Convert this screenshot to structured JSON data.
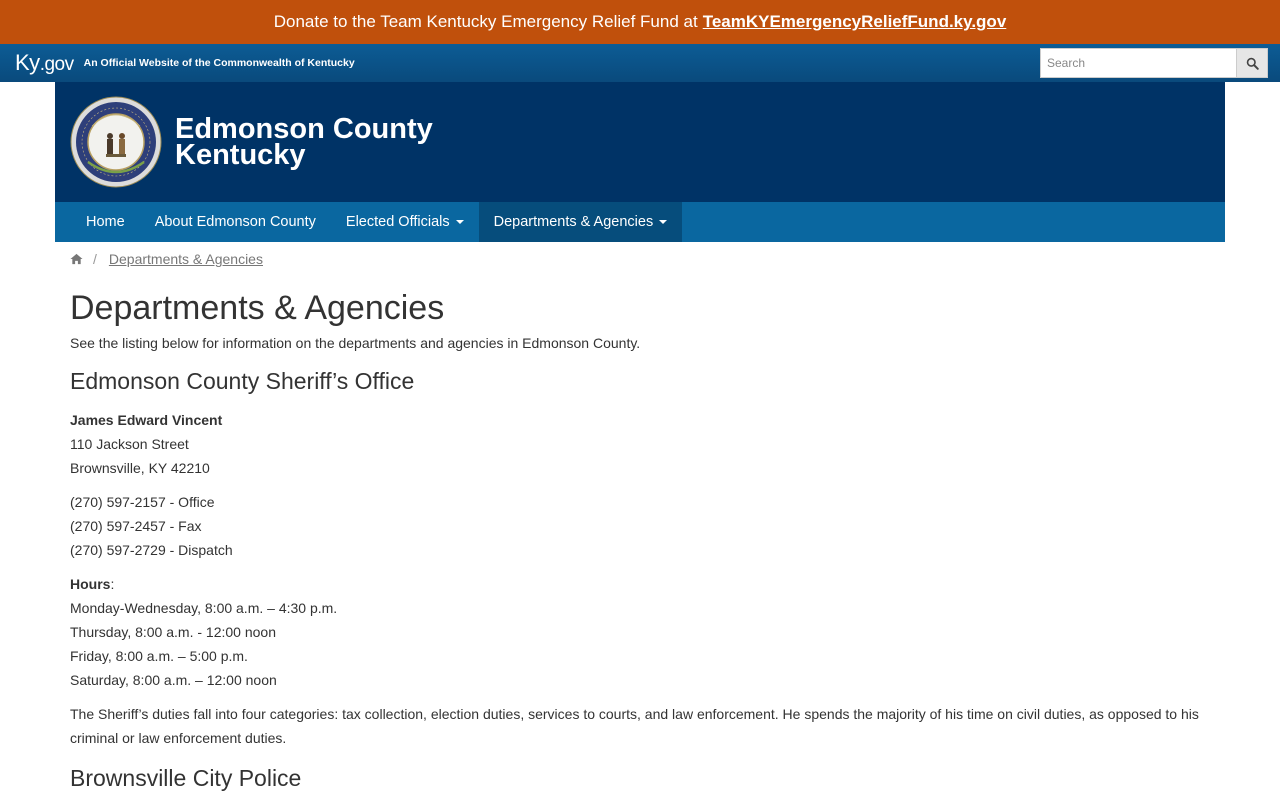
{
  "donate": {
    "text": "Donate to the Team Kentucky Emergency Relief Fund at",
    "link": "TeamKYEmergencyReliefFund.ky.gov"
  },
  "kygov": {
    "logo_ky": "Ky",
    "logo_gov": ".gov",
    "tagline": "An Official Website of the Commonwealth of Kentucky",
    "search_placeholder": "Search"
  },
  "header": {
    "title_line1": "Edmonson County",
    "title_line2": "Kentucky"
  },
  "nav": [
    {
      "label": "Home"
    },
    {
      "label": "About Edmonson County"
    },
    {
      "label": "Elected Officials"
    },
    {
      "label": "Departments & Agencies"
    }
  ],
  "breadcrumb": {
    "separator": "/",
    "current": "Departments & Agencies"
  },
  "page": {
    "title": "Departments & Agencies",
    "intro": "See the listing below for information on the departments and agencies in Edmonson County."
  },
  "sheriff": {
    "heading": "Edmonson County Sheriff’s Office",
    "name": "James Edward Vincent",
    "address1": "110 Jackson Street",
    "address2": "Brownsville, KY 42210",
    "phone_office": "(270) 597-2157 - Office",
    "phone_fax": "(270) 597-2457 - Fax",
    "phone_dispatch": "(270) 597-2729 - Dispatch",
    "hours_label": "Hours",
    "hours": [
      "Monday-Wednesday, 8:00 a.m. – 4:30 p.m.",
      "Thursday, 8:00 a.m. - 12:00 noon",
      "Friday, 8:00 a.m. – 5:00 p.m.",
      "Saturday, 8:00 a.m. – 12:00 noon"
    ],
    "description": "The Sheriff’s duties fall into four categories:  tax collection, election duties, services to courts, and law enforcement.  He spends the majority of his time on civil duties, as opposed to his criminal or law enforcement duties."
  },
  "police": {
    "heading": "Brownsville City Police"
  },
  "colors": {
    "donate_bar": "#c0500c",
    "kygov_bar": "#0a4a7c",
    "header_bg": "#003366",
    "nav_bg": "#0a67a0",
    "nav_active": "#064d7c"
  }
}
